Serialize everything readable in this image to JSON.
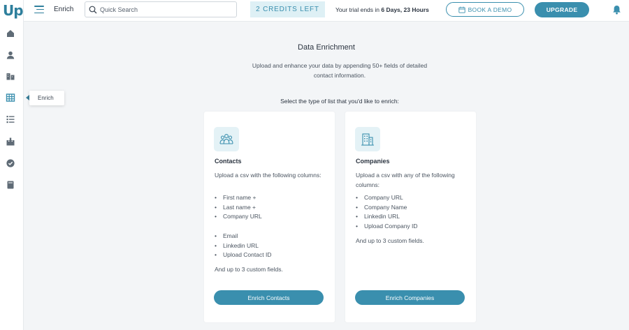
{
  "app": {
    "logo_text": "Up",
    "page_name": "Enrich"
  },
  "header": {
    "search_placeholder": "Quick Search",
    "credits_text": "2 CREDITS LEFT",
    "trial_prefix": "Your trial ends in ",
    "trial_remaining": "6 Days, 23 Hours",
    "book_demo_label": "BOOK A DEMO",
    "upgrade_label": "UPGRADE"
  },
  "sidebar": {
    "items": [
      {
        "icon": "home-icon"
      },
      {
        "icon": "person-icon"
      },
      {
        "icon": "building-icon"
      },
      {
        "icon": "table-icon",
        "active": true
      },
      {
        "icon": "list-icon"
      },
      {
        "icon": "download-icon"
      },
      {
        "icon": "check-circle-icon"
      },
      {
        "icon": "book-icon"
      }
    ],
    "tooltip": "Enrich"
  },
  "main": {
    "title": "Data Enrichment",
    "description": "Upload and enhance your data by appending 50+ fields of detailed contact information.",
    "select_label": "Select the type of list that you'd like to enrich:"
  },
  "cards": {
    "contacts": {
      "icon": "people-group-icon",
      "title": "Contacts",
      "description": "Upload a csv with the following columns:",
      "list_a": [
        "First name +",
        "Last name +",
        "Company URL"
      ],
      "list_b": [
        "Email",
        "Linkedin URL",
        "Upload Contact ID"
      ],
      "custom": "And up to 3 custom fields.",
      "button": "Enrich Contacts"
    },
    "companies": {
      "icon": "office-building-icon",
      "title": "Companies",
      "description": "Upload a csv with any of the following columns:",
      "list": [
        "Company URL",
        "Company Name",
        "Linkedin URL",
        "Upload Company ID"
      ],
      "custom": "And up to 3 custom fields.",
      "button": "Enrich Companies"
    }
  },
  "colors": {
    "accent": "#3a8fae",
    "sidebar_icon": "#5f6b76",
    "credits_bg": "#def0f5"
  }
}
